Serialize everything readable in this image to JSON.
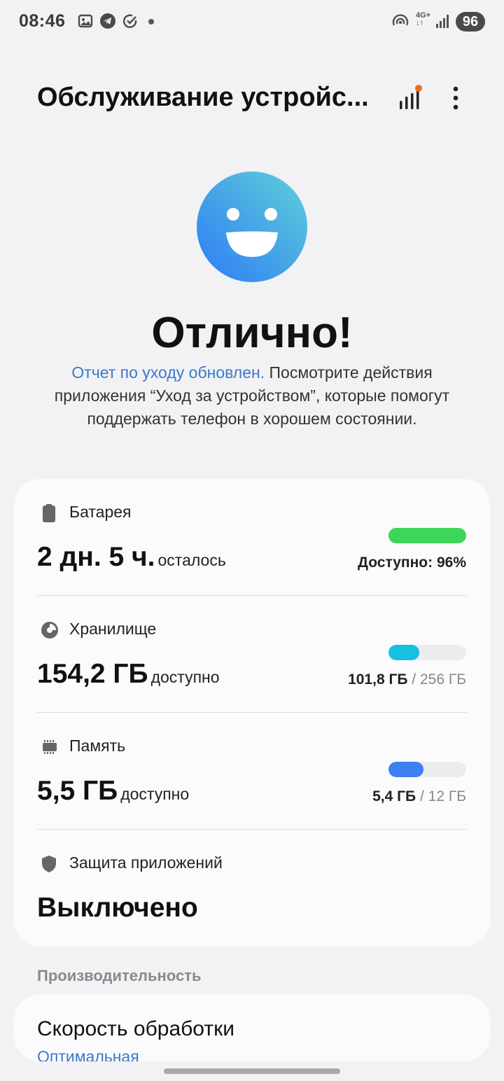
{
  "status_bar": {
    "time": "08:46",
    "network": "4G+",
    "battery": "96",
    "icons": [
      "gallery-icon",
      "telegram-icon",
      "check-circle-icon",
      "dot-icon",
      "hotspot-icon",
      "signal-icon"
    ]
  },
  "header": {
    "title": "Обслуживание устройс...",
    "icons": [
      "diagnostics-icon",
      "more-icon"
    ]
  },
  "hero": {
    "status": "Отлично!",
    "link_text": "Отчет по уходу обновлен.",
    "description": " Посмотрите действия приложения “Уход за устройством”, которые помогут поддержать телефон в хорошем состоянии."
  },
  "items": {
    "battery": {
      "label": "Батарея",
      "value": "2 дн. 5 ч.",
      "suffix": "осталось",
      "right": "Доступно: 96%",
      "level": 0.96,
      "color": "#3dd65a"
    },
    "storage": {
      "label": "Хранилище",
      "value": "154,2 ГБ",
      "suffix": "доступно",
      "used": "101,8 ГБ",
      "total": " / 256 ГБ",
      "level": 0.398,
      "color": "#17bfe0"
    },
    "memory": {
      "label": "Память",
      "value": "5,5 ГБ",
      "suffix": "доступно",
      "used": "5,4 ГБ",
      "total": " / 12 ГБ",
      "level": 0.45,
      "color": "#3d80f0"
    },
    "protection": {
      "label": "Защита приложений",
      "value": "Выключено"
    }
  },
  "performance": {
    "section_label": "Производительность",
    "title": "Скорость обработки",
    "value": "Оптимальная"
  }
}
